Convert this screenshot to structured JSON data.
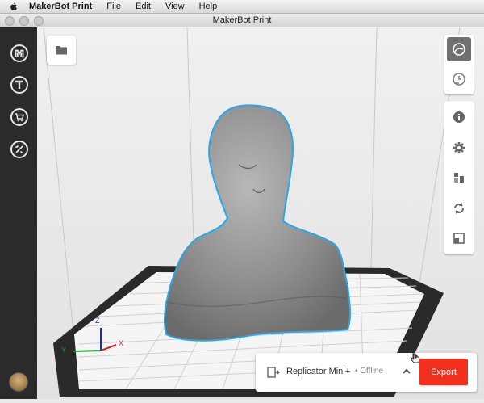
{
  "menubar": {
    "app_name": "MakerBot Print",
    "items": [
      "File",
      "Edit",
      "View",
      "Help"
    ]
  },
  "window": {
    "title": "MakerBot Print"
  },
  "sidebar": {
    "items": [
      {
        "name": "makerbot-logo-icon"
      },
      {
        "name": "thingiverse-icon"
      },
      {
        "name": "store-cart-icon"
      },
      {
        "name": "utilities-wrench-icon"
      }
    ],
    "avatar": "user-avatar"
  },
  "viewport": {
    "object": "bust-model",
    "axes": {
      "x": "X",
      "y": "Y",
      "z": "Z"
    },
    "colors": {
      "x": "#d81e1e",
      "y": "#1c9a32",
      "z": "#1a2fb0",
      "selection": "#29a7e8"
    }
  },
  "right_toolbar": {
    "group1": [
      "view-mode-icon",
      "print-preview-icon"
    ],
    "group2": [
      "info-icon",
      "settings-gear-icon",
      "arrange-icon",
      "rotate-icon",
      "scale-icon"
    ]
  },
  "printer": {
    "name": "Replicator Mini+",
    "status": "• Offline",
    "export_label": "Export",
    "accent": "#f1311d"
  }
}
